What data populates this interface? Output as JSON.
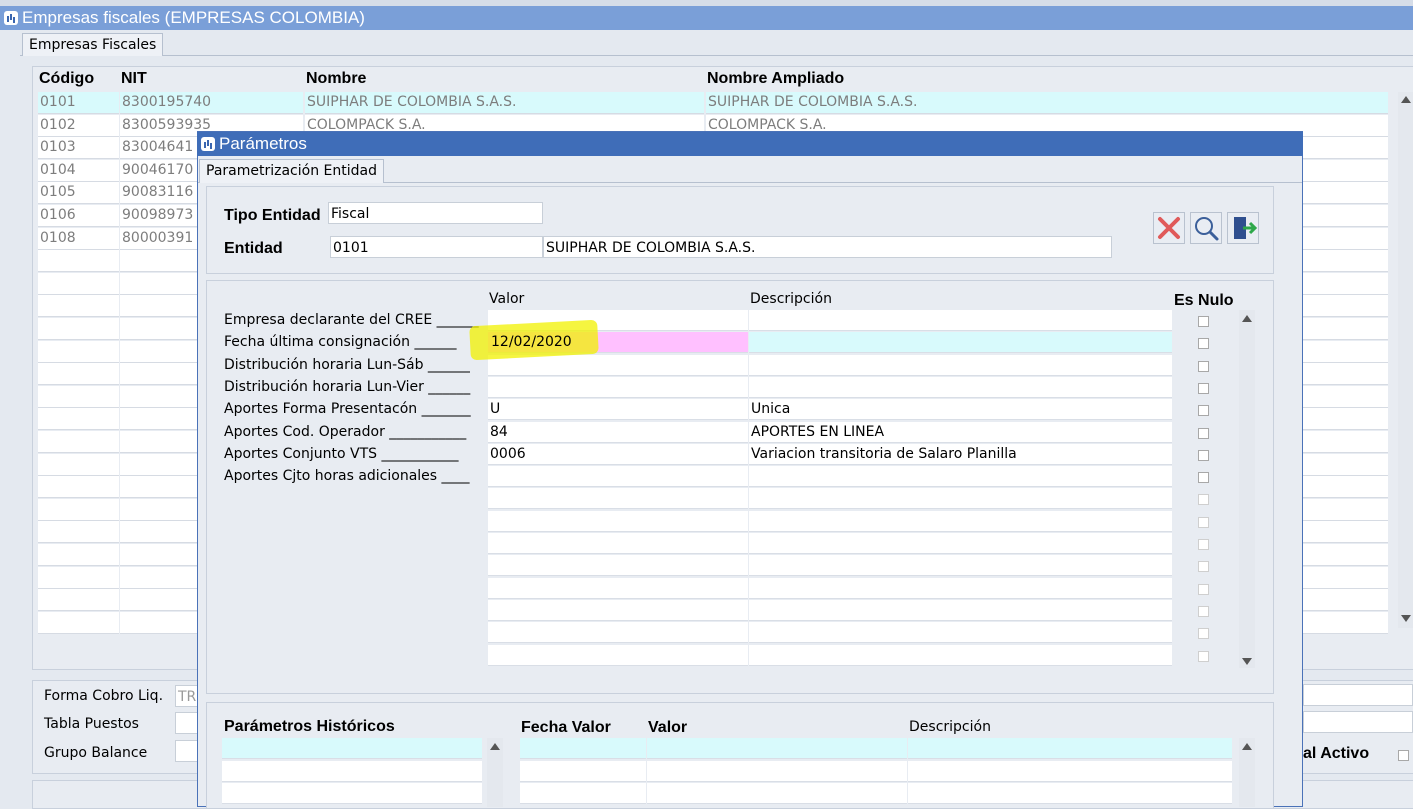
{
  "main_window": {
    "title": "Empresas fiscales (EMPRESAS COLOMBIA)",
    "tab": "Empresas Fiscales",
    "columns": [
      "Código",
      "NIT",
      "Nombre",
      "Nombre Ampliado"
    ],
    "rows": [
      {
        "codigo": "0101",
        "nit": "8300195740",
        "nombre": "SUIPHAR DE COLOMBIA S.A.S.",
        "ampliado": "SUIPHAR DE COLOMBIA S.A.S."
      },
      {
        "codigo": "0102",
        "nit": "8300593935",
        "nombre": "COLOMPACK S.A.",
        "ampliado": "COLOMPACK S.A."
      },
      {
        "codigo": "0103",
        "nit": "83004641",
        "nombre": "",
        "ampliado": ""
      },
      {
        "codigo": "0104",
        "nit": "90046170",
        "nombre": "",
        "ampliado": ""
      },
      {
        "codigo": "0105",
        "nit": "90083116",
        "nombre": "",
        "ampliado": ""
      },
      {
        "codigo": "0106",
        "nit": "90098973",
        "nombre": "",
        "ampliado": ""
      },
      {
        "codigo": "0108",
        "nit": "80000391",
        "nombre": "",
        "ampliado": ""
      }
    ],
    "fields": {
      "forma_cobro_label": "Forma Cobro Liq.",
      "forma_cobro_value": "TR",
      "tabla_puestos_label": "Tabla Puestos",
      "grupo_balance_label": "Grupo Balance",
      "activo_label": "al Activo"
    }
  },
  "dialog": {
    "title": "Parámetros",
    "tab": "Parametrización Entidad",
    "tipo_entidad_label": "Tipo Entidad",
    "tipo_entidad_value": "Fiscal",
    "entidad_label": "Entidad",
    "entidad_code": "0101",
    "entidad_name": "SUIPHAR DE COLOMBIA S.A.S.",
    "toolbar_icons": [
      "delete-icon",
      "search-icon",
      "exit-icon"
    ],
    "param_headers": {
      "valor": "Valor",
      "descripcion": "Descripción",
      "es_nulo": "Es Nulo"
    },
    "params": [
      {
        "label": "Empresa declarante del CREE ______",
        "valor": "",
        "descripcion": ""
      },
      {
        "label": "Fecha última consignación ______",
        "valor": "12/02/2020",
        "descripcion": ""
      },
      {
        "label": "Distribución horaria Lun-Sáb ______",
        "valor": "",
        "descripcion": ""
      },
      {
        "label": "Distribución horaria Lun-Vier ______",
        "valor": "",
        "descripcion": ""
      },
      {
        "label": "Aportes Forma Presentacón _______",
        "valor": "U",
        "descripcion": "Unica"
      },
      {
        "label": "Aportes Cod. Operador ___________",
        "valor": "84",
        "descripcion": "APORTES EN LINEA"
      },
      {
        "label": "Aportes Conjunto VTS ___________",
        "valor": "0006",
        "descripcion": "Variacion transitoria de Salaro Planilla"
      },
      {
        "label": "Aportes Cjto horas adicionales ____",
        "valor": "",
        "descripcion": ""
      }
    ],
    "hist_headers": {
      "parametros": "Parámetros Históricos",
      "fecha_valor": "Fecha Valor",
      "valor": "Valor",
      "descripcion": "Descripción"
    }
  },
  "colors": {
    "titlebar_main": "#7a9fd8",
    "titlebar_dialog": "#3f6db8",
    "selected_row": "#d8fafc",
    "highlight": "#ffc0ff",
    "marker": "#f2f200"
  }
}
